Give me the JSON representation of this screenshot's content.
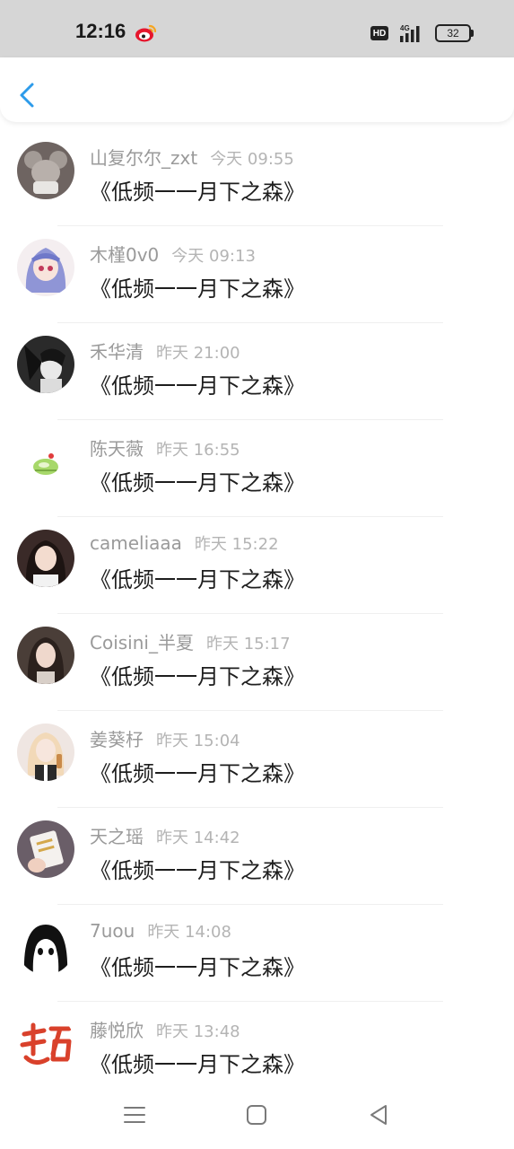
{
  "status_bar": {
    "time": "12:16",
    "hd_label": "HD",
    "network_label": "4G",
    "battery_level": "32",
    "icons": [
      "weibo-icon",
      "hd-icon",
      "signal-icon",
      "battery-icon"
    ]
  },
  "header": {
    "back_icon": "chevron-left-icon",
    "accent_color": "#2d9bea"
  },
  "items": [
    {
      "name": "山复尔尔_zxt",
      "time": "今天 09:55",
      "text": "《低频一一月下之森》"
    },
    {
      "name": "木槿0v0",
      "time": "今天 09:13",
      "text": "《低频一一月下之森》"
    },
    {
      "name": "禾华清",
      "time": "昨天 21:00",
      "text": "《低频一一月下之森》"
    },
    {
      "name": "陈天薇",
      "time": "昨天 16:55",
      "text": "《低频一一月下之森》"
    },
    {
      "name": "cameliaaa",
      "time": "昨天 15:22",
      "text": "《低频一一月下之森》"
    },
    {
      "name": "Coisini_半夏",
      "time": "昨天 15:17",
      "text": "《低频一一月下之森》"
    },
    {
      "name": "姜葵杍",
      "time": "昨天 15:04",
      "text": "《低频一一月下之森》"
    },
    {
      "name": "天之瑶",
      "time": "昨天 14:42",
      "text": "《低频一一月下之森》"
    },
    {
      "name": "7uou",
      "time": "昨天 14:08",
      "text": "《低频一一月下之森》"
    },
    {
      "name": "藤悦欣",
      "time": "昨天 13:48",
      "text": "《低频一一月下之森》"
    }
  ],
  "nav_bar": {
    "icons": [
      "menu-icon",
      "home-icon",
      "back-triangle-icon"
    ]
  }
}
